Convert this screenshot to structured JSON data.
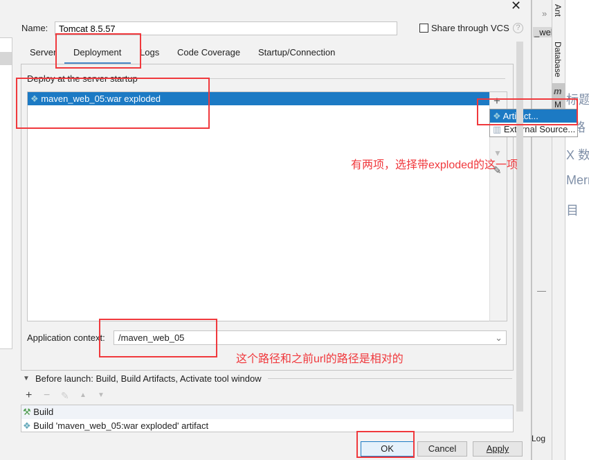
{
  "dialog": {
    "name_label": "Name:",
    "name_value": "Tomcat 8.5.57",
    "share_label": "Share through VCS",
    "help_icon": "?",
    "tabs": [
      {
        "label": "Server"
      },
      {
        "label": "Deployment",
        "active": true
      },
      {
        "label": "Logs"
      },
      {
        "label": "Code Coverage"
      },
      {
        "label": "Startup/Connection"
      }
    ],
    "deploy_title": "Deploy at the server startup",
    "deploy_items": [
      {
        "label": "maven_web_05:war exploded",
        "selected": true
      }
    ],
    "add_menu": [
      {
        "label": "Artifact...",
        "highlighted": true
      },
      {
        "label": "External Source..."
      }
    ],
    "app_context_label": "Application context:",
    "app_context_value": "/maven_web_05",
    "before_launch_label": "Before launch: Build, Build Artifacts, Activate tool window",
    "before_launch_items": [
      {
        "label": "Build"
      },
      {
        "label": "Build 'maven_web_05:war exploded' artifact"
      }
    ],
    "buttons": {
      "ok": "OK",
      "cancel": "Cancel",
      "apply": "Apply"
    }
  },
  "ide": {
    "tab_fragment": "_web",
    "chevron": "»",
    "side_tabs": [
      "Ant",
      "Database",
      "M"
    ],
    "log_label": "Log",
    "bg_fragments": [
      "标题",
      "路",
      "X 数",
      "Merr",
      "目"
    ]
  },
  "annotations": {
    "note1": "有两项，选择带exploded的这一项",
    "note2": "这个路径和之前url的路径是相对的"
  },
  "colors": {
    "selection": "#1c7ac4",
    "annotation": "#f0383c",
    "tab_underline": "#4a88c7"
  }
}
